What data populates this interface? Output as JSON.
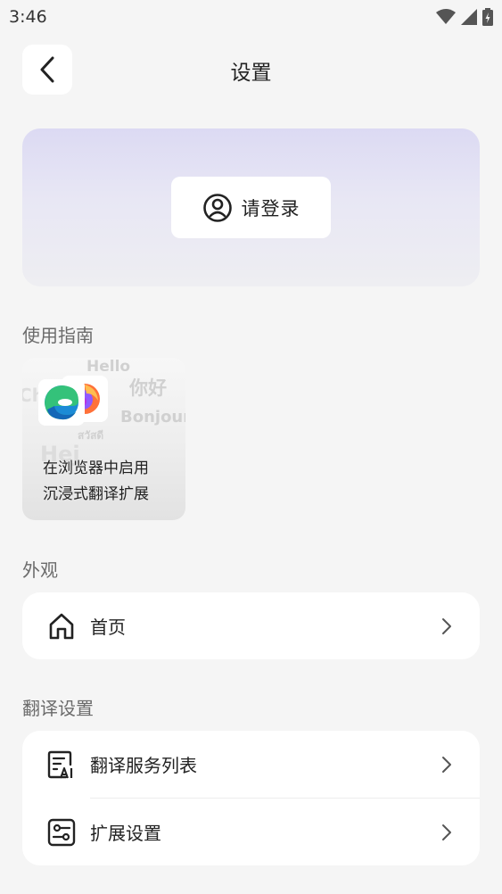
{
  "status_bar": {
    "time": "3:46"
  },
  "header": {
    "title": "设置",
    "back_icon": "chevron-left-icon"
  },
  "login": {
    "label": "请登录",
    "icon": "user-circle-icon"
  },
  "guide_section": {
    "title": "使用指南",
    "card": {
      "line1": "在浏览器中启用",
      "line2": "沉浸式翻译扩展",
      "background_words": [
        "Hello",
        "你好",
        "Bonjour",
        "สวัสดี",
        "Hej",
        "Ch"
      ]
    }
  },
  "appearance_section": {
    "title": "外观",
    "items": [
      {
        "label": "首页",
        "icon": "home-icon"
      }
    ]
  },
  "translation_section": {
    "title": "翻译设置",
    "items": [
      {
        "label": "翻译服务列表",
        "icon": "ai-document-icon"
      },
      {
        "label": "扩展设置",
        "icon": "sliders-icon"
      }
    ]
  },
  "colors": {
    "background": "#f5f5f5",
    "card": "#ffffff",
    "login_gradient_top": "#dcdaf3",
    "text_primary": "#222222",
    "text_secondary": "#6b6b6b"
  }
}
